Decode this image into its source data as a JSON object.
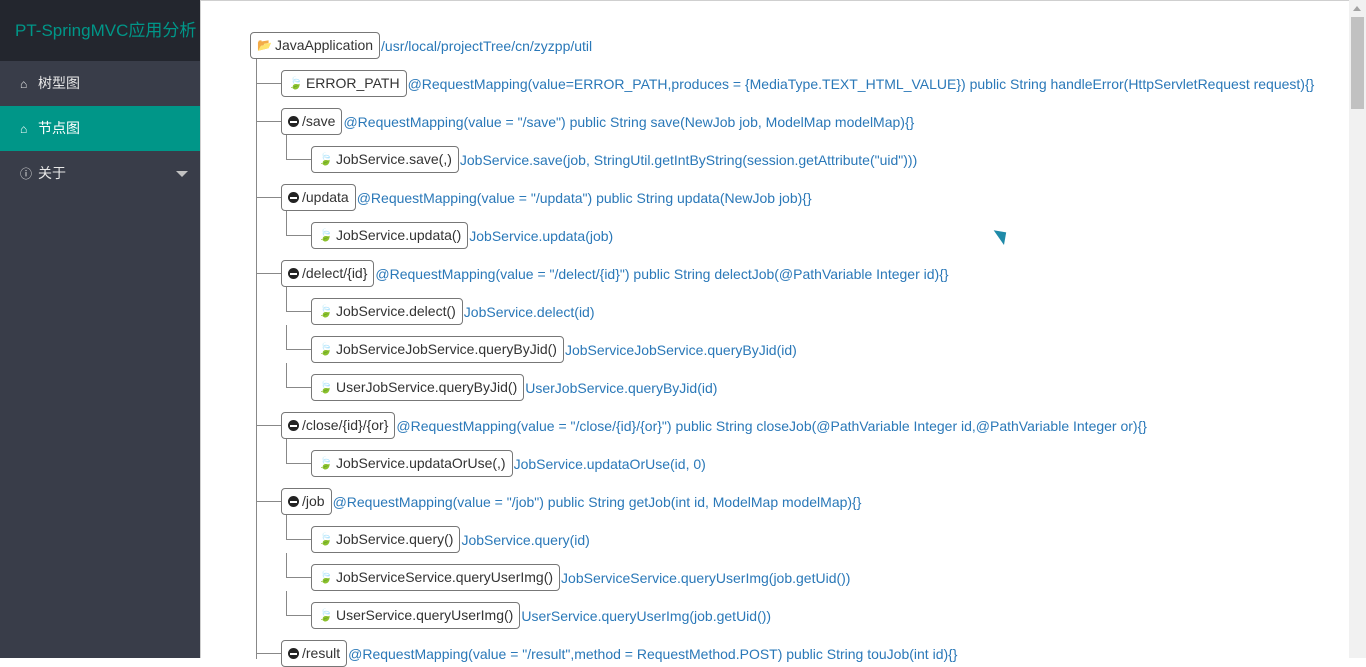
{
  "app": {
    "title": "PT-SpringMVC应用分析"
  },
  "nav": [
    {
      "icon": "home-icon",
      "glyph": "⌂",
      "label": "树型图",
      "active": false
    },
    {
      "icon": "home-icon",
      "glyph": "⌂",
      "label": "节点图",
      "active": true
    },
    {
      "icon": "info-icon",
      "glyph": "ⓘ",
      "label": "关于",
      "active": false,
      "dropdown": true
    }
  ],
  "tree": {
    "root": {
      "label": "JavaApplication",
      "desc": "/usr/local/projectTree/cn/zyzpp/util"
    },
    "nodes": [
      {
        "level": 1,
        "kind": "leaf",
        "label": "ERROR_PATH",
        "desc": "@RequestMapping(value=ERROR_PATH,produces = {MediaType.TEXT_HTML_VALUE}) public String handleError(HttpServletRequest request){}"
      },
      {
        "level": 1,
        "kind": "branch",
        "label": "/save",
        "desc": "@RequestMapping(value = \"/save\") public String save(NewJob job, ModelMap modelMap){}"
      },
      {
        "level": 2,
        "kind": "leaf",
        "label": "JobService.save(,)",
        "desc": "JobService.save(job, StringUtil.getIntByString(session.getAttribute(\"uid\")))"
      },
      {
        "level": 1,
        "kind": "branch",
        "label": "/updata",
        "desc": "@RequestMapping(value = \"/updata\") public String updata(NewJob job){}"
      },
      {
        "level": 2,
        "kind": "leaf",
        "label": "JobService.updata()",
        "desc": "JobService.updata(job)"
      },
      {
        "level": 1,
        "kind": "branch",
        "label": "/delect/{id}",
        "desc": "@RequestMapping(value = \"/delect/{id}\") public String delectJob(@PathVariable Integer id){}"
      },
      {
        "level": 2,
        "kind": "leaf",
        "label": "JobService.delect()",
        "desc": "JobService.delect(id)"
      },
      {
        "level": 2,
        "kind": "leaf",
        "label": "JobServiceJobService.queryByJid()",
        "desc": "JobServiceJobService.queryByJid(id)"
      },
      {
        "level": 2,
        "kind": "leaf",
        "label": "UserJobService.queryByJid()",
        "desc": "UserJobService.queryByJid(id)"
      },
      {
        "level": 1,
        "kind": "branch",
        "label": "/close/{id}/{or}",
        "desc": "@RequestMapping(value = \"/close/{id}/{or}\") public String closeJob(@PathVariable Integer id,@PathVariable Integer or){}"
      },
      {
        "level": 2,
        "kind": "leaf",
        "label": "JobService.updataOrUse(,)",
        "desc": "JobService.updataOrUse(id, 0)"
      },
      {
        "level": 1,
        "kind": "branch",
        "label": "/job",
        "desc": "@RequestMapping(value = \"/job\") public String getJob(int id, ModelMap modelMap){}"
      },
      {
        "level": 2,
        "kind": "leaf",
        "label": "JobService.query()",
        "desc": "JobService.query(id)"
      },
      {
        "level": 2,
        "kind": "leaf",
        "label": "JobServiceService.queryUserImg()",
        "desc": "JobServiceService.queryUserImg(job.getUid())"
      },
      {
        "level": 2,
        "kind": "leaf",
        "label": "UserService.queryUserImg()",
        "desc": "UserService.queryUserImg(job.getUid())"
      },
      {
        "level": 1,
        "kind": "branch",
        "label": "/result",
        "desc": "@RequestMapping(value = \"/result\",method = RequestMethod.POST) public String touJob(int id){}"
      }
    ]
  },
  "icons": {
    "folder": "folder-open-icon",
    "leaf": "leaf-icon",
    "branch": "minus-circle-icon"
  },
  "colors": {
    "accent": "#009688",
    "sidebar": "#393d49",
    "brand_bg": "#23262e",
    "link": "#2a78b8"
  }
}
